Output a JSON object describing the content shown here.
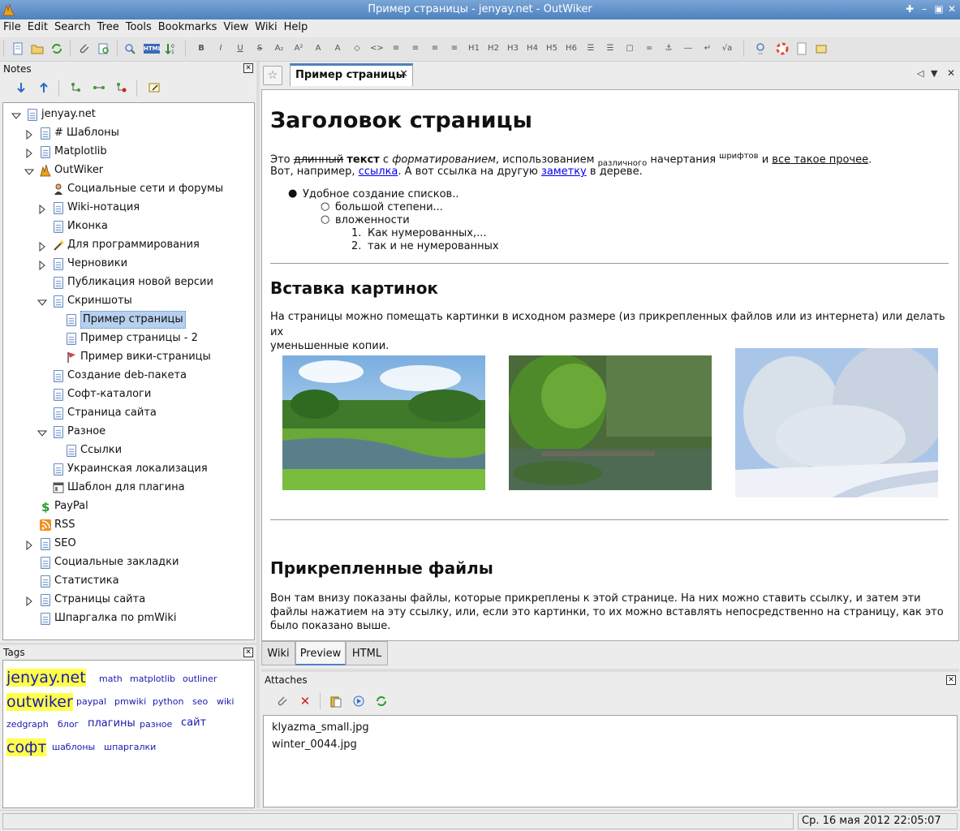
{
  "window": {
    "title": "Пример страницы - jenyay.net - OutWiker"
  },
  "menu": [
    "File",
    "Edit",
    "Search",
    "Tree",
    "Tools",
    "Bookmarks",
    "View",
    "Wiki",
    "Help"
  ],
  "toolbar_text_icons": {
    "bold": "B",
    "italic": "I",
    "underline": "U",
    "strike": "S",
    "h1": "H1",
    "h2": "H2",
    "h3": "H3",
    "h4": "H4",
    "h5": "H5",
    "h6": "H6",
    "html": "HTML"
  },
  "notes": {
    "header": "Notes",
    "tree": [
      {
        "label": "jenyay.net",
        "level": 0,
        "expander": "open",
        "icon": "page-icon"
      },
      {
        "label": "# Шаблоны",
        "level": 1,
        "expander": "closed",
        "icon": "page-icon"
      },
      {
        "label": "Matplotlib",
        "level": 1,
        "expander": "closed",
        "icon": "page-icon"
      },
      {
        "label": "OutWiker",
        "level": 1,
        "expander": "open",
        "icon": "outwiker-icon"
      },
      {
        "label": "Социальные сети и форумы",
        "level": 2,
        "expander": "none",
        "icon": "person-icon"
      },
      {
        "label": "Wiki-нотация",
        "level": 2,
        "expander": "closed",
        "icon": "page-icon"
      },
      {
        "label": "Иконка",
        "level": 2,
        "expander": "none",
        "icon": "page-icon"
      },
      {
        "label": "Для программирования",
        "level": 2,
        "expander": "closed",
        "icon": "wand-icon"
      },
      {
        "label": "Черновики",
        "level": 2,
        "expander": "closed",
        "icon": "page-icon"
      },
      {
        "label": "Публикация новой версии",
        "level": 2,
        "expander": "none",
        "icon": "page-icon"
      },
      {
        "label": "Скриншоты",
        "level": 2,
        "expander": "open",
        "icon": "page-icon"
      },
      {
        "label": "Пример страницы",
        "level": 3,
        "expander": "none",
        "icon": "page-icon",
        "selected": true
      },
      {
        "label": "Пример страницы - 2",
        "level": 3,
        "expander": "none",
        "icon": "page-icon"
      },
      {
        "label": "Пример вики-страницы",
        "level": 3,
        "expander": "none",
        "icon": "flag-icon"
      },
      {
        "label": "Создание deb-пакета",
        "level": 2,
        "expander": "none",
        "icon": "page-icon"
      },
      {
        "label": "Софт-каталоги",
        "level": 2,
        "expander": "none",
        "icon": "page-icon"
      },
      {
        "label": "Страница сайта",
        "level": 2,
        "expander": "none",
        "icon": "page-icon"
      },
      {
        "label": "Разное",
        "level": 2,
        "expander": "open",
        "icon": "page-icon"
      },
      {
        "label": "Ссылки",
        "level": 3,
        "expander": "none",
        "icon": "page-icon"
      },
      {
        "label": "Украинская локализация",
        "level": 2,
        "expander": "none",
        "icon": "page-icon"
      },
      {
        "label": "Шаблон для плагина",
        "level": 2,
        "expander": "none",
        "icon": "window-icon"
      },
      {
        "label": "PayPal",
        "level": 1,
        "expander": "none",
        "icon": "dollar-icon"
      },
      {
        "label": "RSS",
        "level": 1,
        "expander": "none",
        "icon": "rss-icon"
      },
      {
        "label": "SEO",
        "level": 1,
        "expander": "closed",
        "icon": "page-icon"
      },
      {
        "label": "Социальные закладки",
        "level": 1,
        "expander": "none",
        "icon": "page-icon"
      },
      {
        "label": "Статистика",
        "level": 1,
        "expander": "none",
        "icon": "page-icon"
      },
      {
        "label": "Страницы сайта",
        "level": 1,
        "expander": "closed",
        "icon": "page-icon"
      },
      {
        "label": "Шпаргалка по pmWiki",
        "level": 1,
        "expander": "none",
        "icon": "page-icon"
      }
    ]
  },
  "tags": {
    "header": "Tags",
    "items": [
      {
        "label": "jenyay.net",
        "size": "large",
        "highlight": true
      },
      {
        "label": "math",
        "size": "small"
      },
      {
        "label": "matplotlib",
        "size": "small"
      },
      {
        "label": "outliner",
        "size": "small"
      },
      {
        "label": "outwiker",
        "size": "large",
        "highlight": true
      },
      {
        "label": "paypal",
        "size": "small"
      },
      {
        "label": "pmwiki",
        "size": "small"
      },
      {
        "label": "python",
        "size": "small"
      },
      {
        "label": "seo",
        "size": "small"
      },
      {
        "label": "wiki",
        "size": "small"
      },
      {
        "label": "zedgraph",
        "size": "small"
      },
      {
        "label": "блог",
        "size": "small"
      },
      {
        "label": "плагины",
        "size": "medium"
      },
      {
        "label": "разное",
        "size": "small"
      },
      {
        "label": "сайт",
        "size": "medium"
      },
      {
        "label": "софт",
        "size": "large",
        "highlight": true
      },
      {
        "label": "шаблоны",
        "size": "small"
      },
      {
        "label": "шпаргалки",
        "size": "small"
      }
    ]
  },
  "editor": {
    "tab_label": "Пример страницы",
    "tab_close": "✕",
    "h1": "Заголовок страницы",
    "p1": {
      "t1": "Это ",
      "strike": "длинный",
      "bold": "текст",
      "t2": " с ",
      "italic": "форматированием",
      "t3": ", использованием ",
      "sub": "различного",
      "t4": " начертания ",
      "sup": "шрифтов",
      "t5": " и ",
      "underline": "все такое прочее",
      "t6": "."
    },
    "p2": {
      "t1": "Вот, например, ",
      "link1": "ссылка",
      "t2": ". А вот ссылка на другую ",
      "link2": "заметку",
      "t3": " в дереве."
    },
    "list": {
      "l1": "Удобное создание списков..",
      "l2a": "большой степени...",
      "l2b": "вложенности",
      "n1_num": "1.",
      "n1": "Как нумерованных,...",
      "n2_num": "2.",
      "n2": "так и не нумерованных"
    },
    "h2_images": "Вставка картинок",
    "p_images_1": "На страницы можно помещать картинки в исходном размере (из прикрепленных файлов или из интернета) или делать их",
    "p_images_2": "уменьшенные копии.",
    "h2_attach": "Прикрепленные файлы",
    "p_attach_1": "Вон там внизу показаны файлы, которые прикреплены к этой странице. На них можно ставить ссылку, и затем эти",
    "p_attach_2": "файлы нажатием на эту ссылку, или, если это картинки, то их можно вставлять непосредственно на страницу, как это",
    "p_attach_3": "было показано выше.",
    "bottom_tabs": [
      {
        "label": "Wiki",
        "active": false
      },
      {
        "label": "Preview",
        "active": true
      },
      {
        "label": "HTML",
        "active": false
      }
    ]
  },
  "attaches": {
    "header": "Attaches",
    "files": [
      "klyazma_small.jpg",
      "winter_0044.jpg"
    ]
  },
  "status": {
    "datetime": "Ср. 16 мая 2012 22:05:07"
  }
}
